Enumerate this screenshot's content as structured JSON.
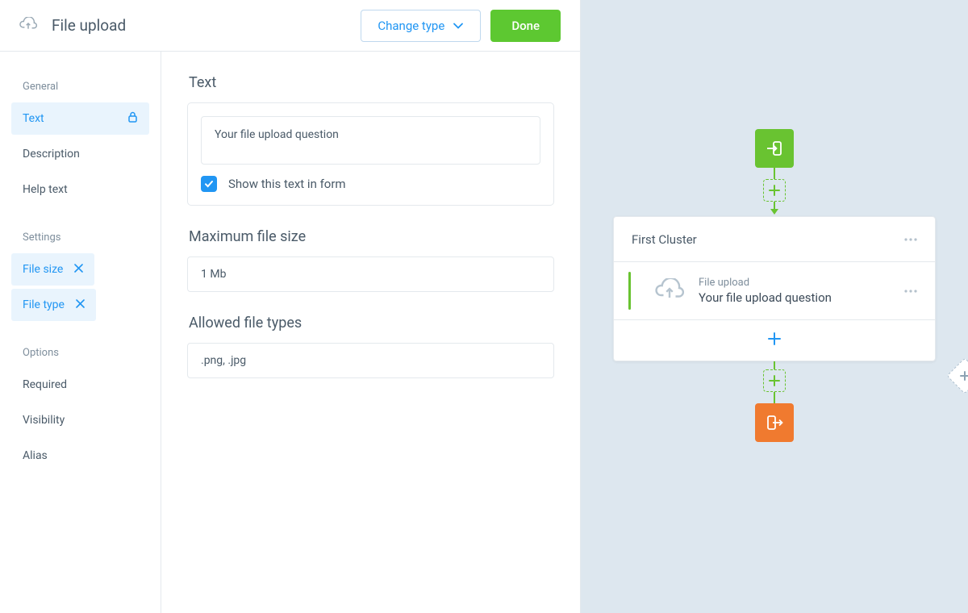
{
  "header": {
    "title": "File upload",
    "change_type_label": "Change type",
    "done_label": "Done"
  },
  "sidebar": {
    "sections": {
      "general": "General",
      "settings": "Settings",
      "options": "Options"
    },
    "general_items": [
      {
        "label": "Text",
        "active": true,
        "locked": true
      },
      {
        "label": "Description"
      },
      {
        "label": "Help text"
      }
    ],
    "settings_items": [
      {
        "label": "File size",
        "active": true,
        "removable": true
      },
      {
        "label": "File type",
        "active": true,
        "removable": true
      }
    ],
    "options_items": [
      {
        "label": "Required"
      },
      {
        "label": "Visibility"
      },
      {
        "label": "Alias"
      }
    ]
  },
  "form": {
    "text_section_title": "Text",
    "text_value": "Your file upload question",
    "show_in_form_label": "Show this text in form",
    "show_in_form_checked": true,
    "max_size_title": "Maximum file size",
    "max_size_value": "1 Mb",
    "allowed_types_title": "Allowed file types",
    "allowed_types_value": ".png, .jpg"
  },
  "canvas": {
    "cluster_title": "First Cluster",
    "question_type": "File upload",
    "question_text": "Your file upload question"
  }
}
